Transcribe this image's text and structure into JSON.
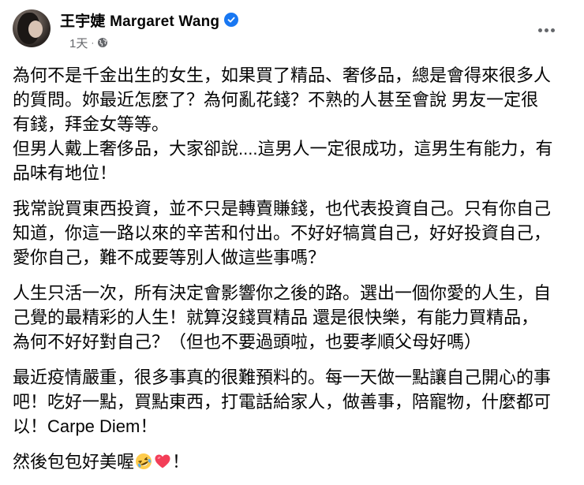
{
  "author": {
    "name": "王宇婕 Margaret Wang",
    "verified": true,
    "avatar_icon": "profile-photo"
  },
  "meta": {
    "timestamp": "1天",
    "separator": "·",
    "audience_icon": "globe-icon"
  },
  "menu_icon": "more-options-icon",
  "paragraphs": [
    {
      "lines": [
        "為何不是千金出生的女生，如果買了精品、奢侈品，總是會得來很多人",
        "的質問。妳最近怎麼了？為何亂花錢？不熟的人甚至會說 男友一定很",
        "有錢，拜金女等等。",
        "但男人戴上奢侈品，大家卻說....這男人一定很成功，這男生有能力，有",
        "品味有地位！"
      ]
    },
    {
      "lines": [
        "我常說買東西投資，並不只是轉賣賺錢，也代表投資自己。只有你自己",
        "知道，你這一路以來的辛苦和付出。不好好犒賞自己，好好投資自己，",
        "愛你自己，難不成要等別人做這些事嗎？"
      ]
    },
    {
      "lines": [
        "人生只活一次，所有決定會影響你之後的路。選出一個你愛的人生，自",
        "己覺的最精彩的人生！就算沒錢買精品 還是很快樂，有能力買精品，",
        "為何不好好對自己？（但也不要過頭啦，也要孝順父母好嗎）"
      ]
    },
    {
      "lines": [
        "最近疫情嚴重，很多事真的很難預料的。每一天做一點讓自己開心的事",
        "吧！吃好一點，買點東西，打電話給家人，做善事，陪寵物，什麼都可",
        "以！Carpe Diem！"
      ]
    }
  ],
  "last_line": {
    "text_before": "然後包包好美喔",
    "emojis": [
      "rolling-laughing-emoji",
      "red-heart-emoji"
    ],
    "text_after": "！"
  },
  "colors": {
    "text": "#050505",
    "secondary_text": "#65676b",
    "verified_badge": "#1877f2",
    "heart": "#f33e58",
    "emoji_face": "#ffcc4d"
  }
}
